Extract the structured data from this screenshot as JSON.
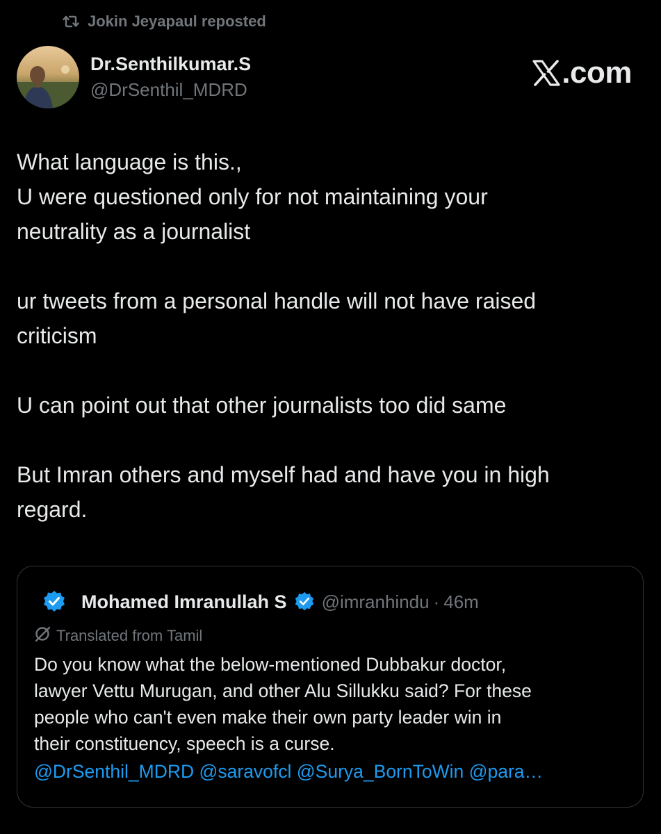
{
  "repost": {
    "label": "Jokin Jeyapaul reposted",
    "icon": "repost-icon"
  },
  "author": {
    "name": "Dr.Senthilkumar.S",
    "handle": "@DrSenthil_MDRD"
  },
  "brand": {
    "label": ".com",
    "icon": "x-logo-icon"
  },
  "tweet": {
    "lines": [
      "What language is this.,",
      "U were questioned only for not maintaining your",
      "neutrality as a journalist",
      "ur tweets from a personal handle will not have raised",
      "criticism",
      "U can point out that other journalists too did  same",
      "But Imran others and myself had and have you in high",
      "regard."
    ]
  },
  "quote": {
    "name": "Mohamed Imranullah S",
    "handle": "@imranhindu",
    "separator": "·",
    "time": "46m",
    "translated_label": "Translated from Tamil",
    "text_lines": [
      "Do you know what the below-mentioned Dubbakur doctor,",
      "lawyer Vettu Murugan, and other Alu Sillukku said? For these",
      "people who can't even make their own party leader win in",
      "their constituency, speech is a curse."
    ],
    "mentions": "@DrSenthil_MDRD @saravofcl @Surya_BornToWin @para…"
  },
  "colors": {
    "background": "#000000",
    "text": "#e7e9ea",
    "muted": "#71767b",
    "link": "#1d9bf0",
    "border": "#2f3336"
  }
}
